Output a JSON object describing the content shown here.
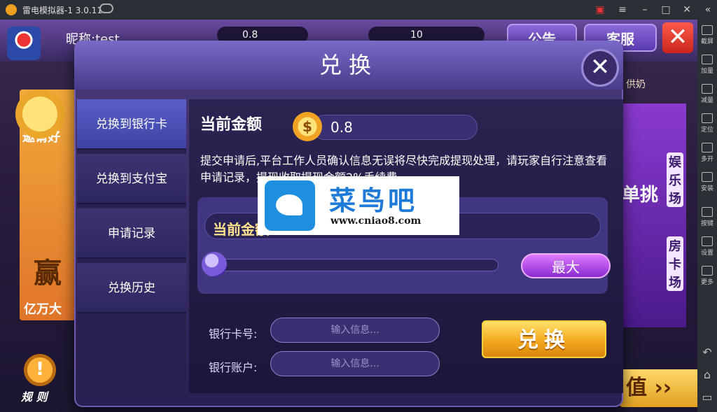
{
  "emulator": {
    "title": "雷电模拟器-1 3.0.11",
    "sidebar": [
      {
        "label": "截屏",
        "icon": "scissors-icon"
      },
      {
        "label": "加量",
        "icon": "volume-up-icon"
      },
      {
        "label": "减量",
        "icon": "volume-down-icon"
      },
      {
        "label": "定位",
        "icon": "location-icon"
      },
      {
        "label": "多开",
        "icon": "multi-instance-icon"
      },
      {
        "label": "安装",
        "icon": "install-icon"
      },
      {
        "label": "按键",
        "icon": "keyboard-icon"
      },
      {
        "label": "设置",
        "icon": "gear-icon"
      },
      {
        "label": "更多",
        "icon": "more-icon"
      }
    ]
  },
  "game": {
    "nickname": "昵称:test",
    "coins": "0.8",
    "bank": "10",
    "notice_btn": "公告",
    "service_btn": "客服",
    "left_promo_top": "邀请好",
    "left_promo_bottom": "亿万大",
    "left_promo_big": "赢",
    "right_promo_top": "供奶",
    "right_promo_v1": "娱乐场",
    "right_promo_v2": "房卡场",
    "right_promo_mid": "单挑",
    "rules_label": "规 则",
    "bottom_right": "值"
  },
  "dialog": {
    "title": "兑换",
    "tabs": [
      "兑换到银行卡",
      "兑换到支付宝",
      "申请记录",
      "兑换历史"
    ],
    "active_tab": 0,
    "current_amount_label": "当前金额",
    "current_amount": "0.8",
    "notice": "提交申请后,平台工作人员确认信息无误将尽快完成提现处理，请玩家自行注意查看申请记录，提现收取提现金额2%手续费。",
    "panel_label": "当前金额",
    "slider_value": 0,
    "max_label": "最大",
    "bank_card_label": "银行卡号:",
    "bank_account_label": "银行账户:",
    "input_placeholder": "输入信息...",
    "confirm_label": "兑换"
  },
  "watermark": {
    "title": "菜鸟吧",
    "url": "www.cniao8.com"
  }
}
